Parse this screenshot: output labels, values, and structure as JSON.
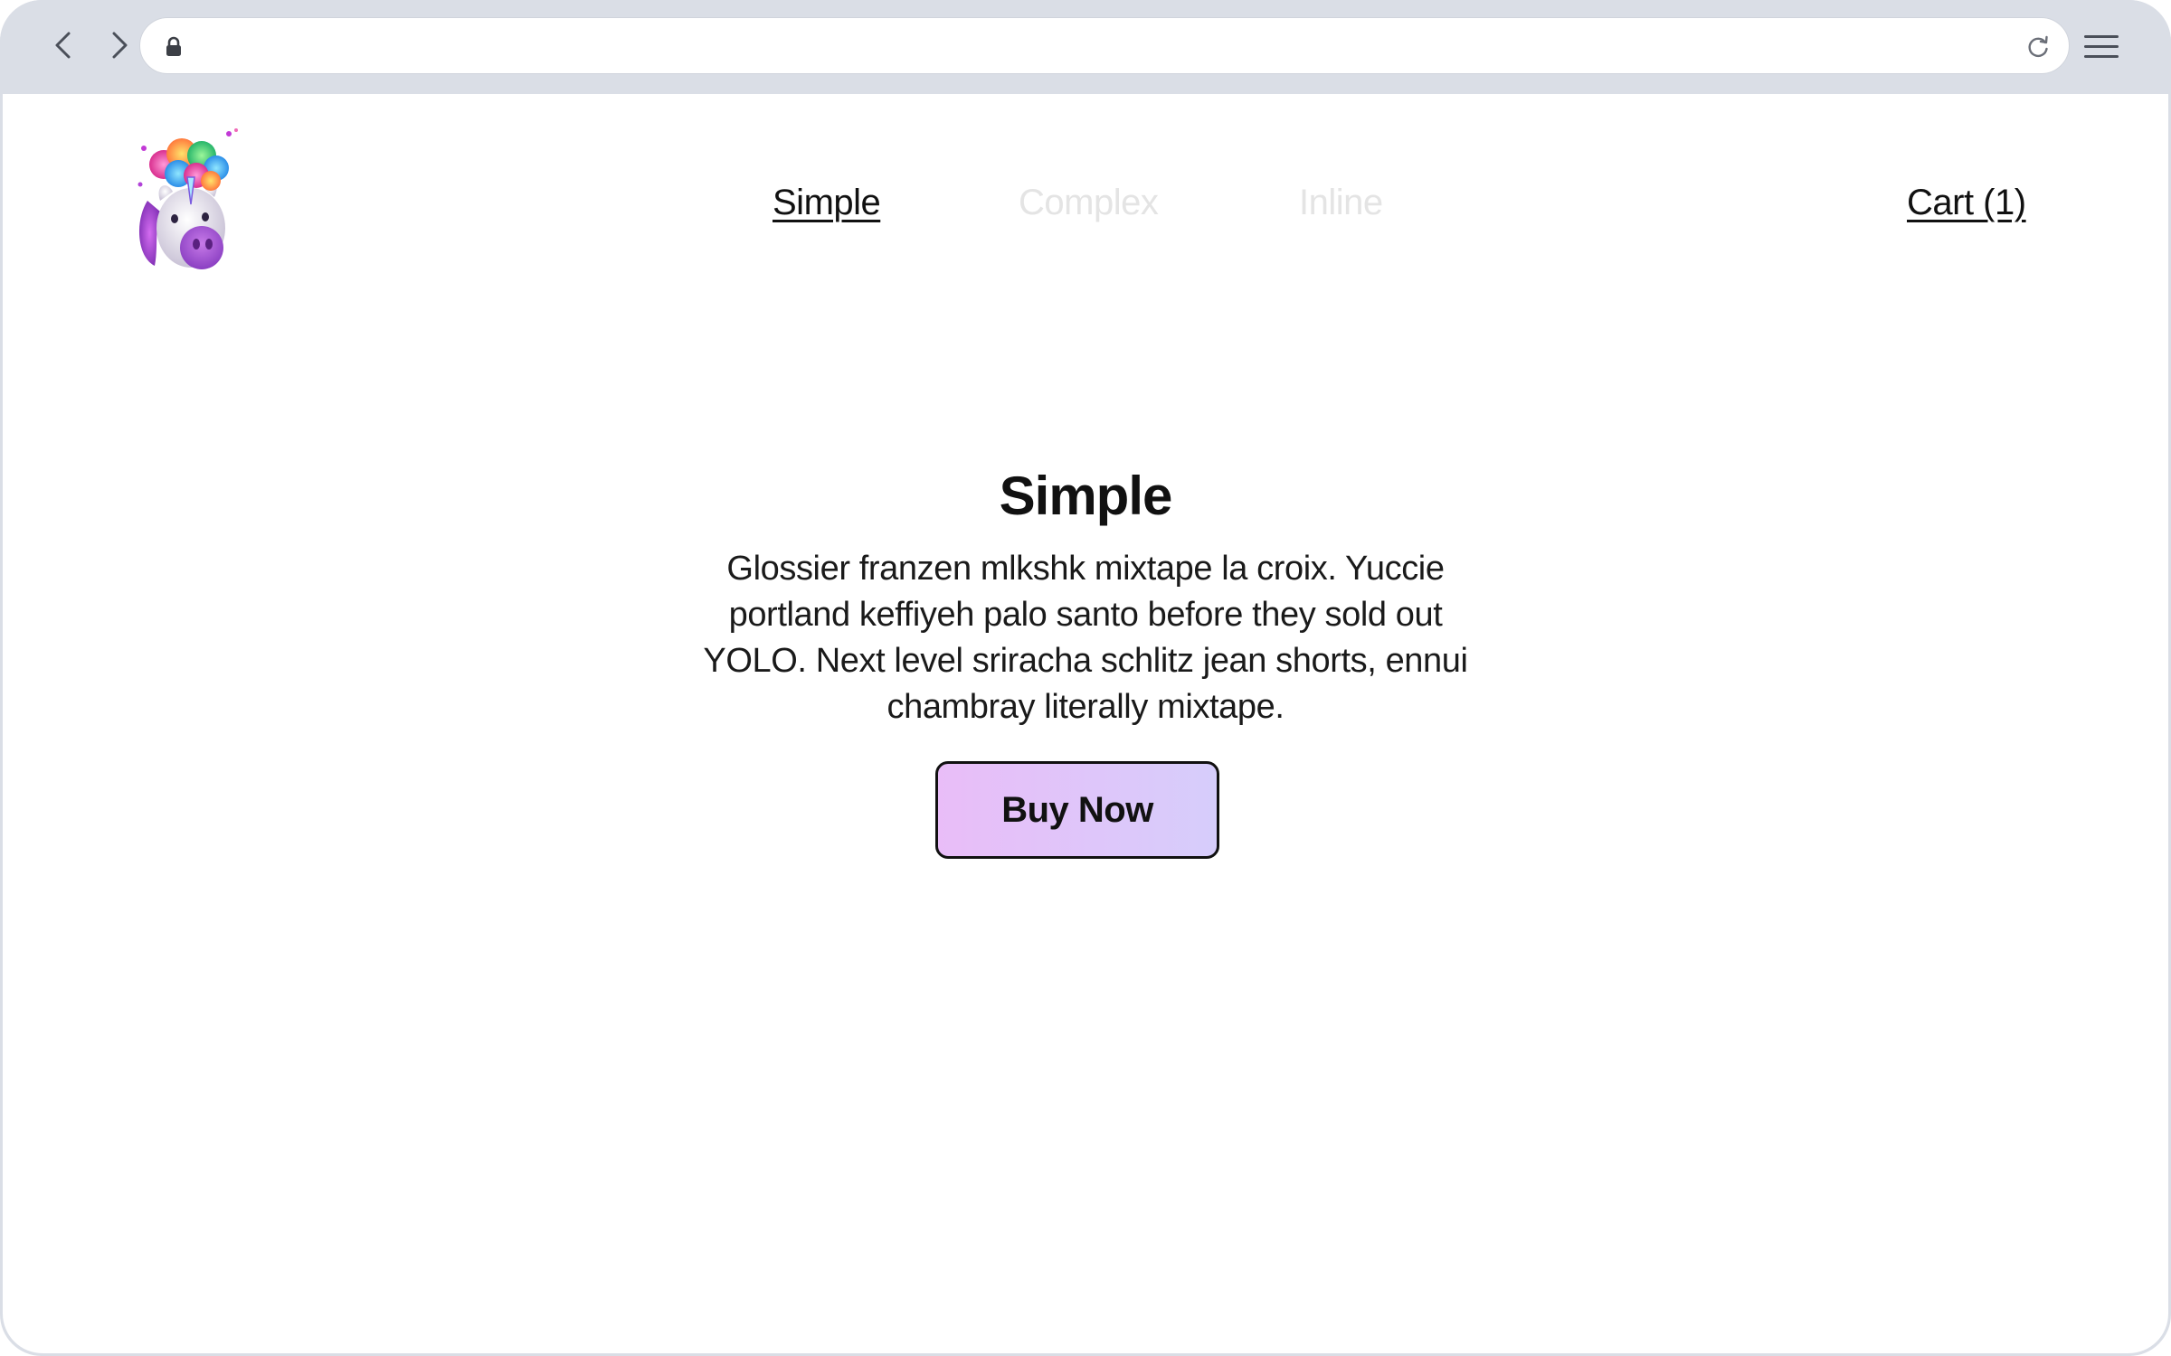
{
  "browser": {
    "back_icon": "chevron-left-icon",
    "forward_icon": "chevron-right-icon",
    "lock_icon": "lock-icon",
    "reload_icon": "reload-icon",
    "menu_icon": "hamburger-menu-icon",
    "url": ""
  },
  "site": {
    "logo": "unicorn-logo",
    "nav": {
      "simple": "Simple",
      "complex": "Complex",
      "inline": "Inline",
      "cart": "Cart (1)"
    }
  },
  "hero": {
    "title": "Simple",
    "body": "Glossier franzen mlkshk mixtape la croix. Yuccie portland keffiyeh palo santo before they sold out YOLO. Next level sriracha schlitz jean shorts, ennui chambray literally mixtape.",
    "cta": "Buy Now"
  },
  "colors": {
    "chrome": "#dadee6",
    "button_gradient_start": "#e9bdf8",
    "button_gradient_end": "#d6cdfb",
    "inactive_nav": "#e4e4e4",
    "text": "#111111"
  }
}
